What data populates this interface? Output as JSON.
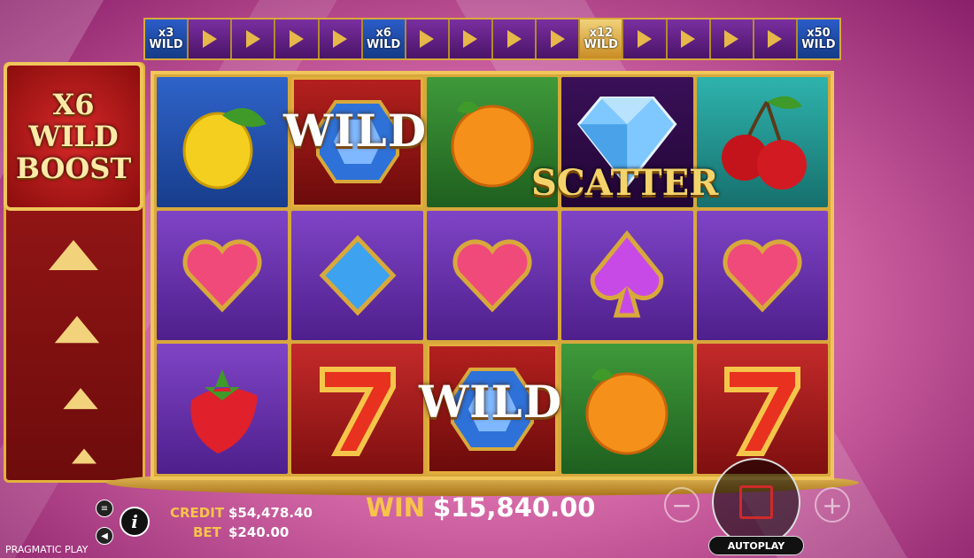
{
  "multipliers": [
    "x3\nWILD",
    "x6\nWILD",
    "x12\nWILD",
    "x50\nWILD"
  ],
  "boost": {
    "line1": "X6",
    "line2": "WILD",
    "line3": "BOOST"
  },
  "symbols": {
    "wild": "WILD",
    "scatter": "SCATTER"
  },
  "reels": [
    [
      "lemon",
      "wild-gem",
      "orange",
      "diamond-scatter",
      "cherries"
    ],
    [
      "heart",
      "blue-diamond",
      "heart",
      "spade",
      "heart"
    ],
    [
      "strawberry",
      "seven",
      "wild-gem",
      "orange",
      "seven"
    ]
  ],
  "hud": {
    "credit_label": "CREDIT",
    "credit_value": "$54,478.40",
    "bet_label": "BET",
    "bet_value": "$240.00",
    "win_label": "WIN",
    "win_value": "$15,840.00",
    "autoplay_label": "AUTOPLAY",
    "info_label": "i",
    "brand": "PRAGMATIC PLAY",
    "minus": "−",
    "plus": "+"
  },
  "colors": {
    "gold": "#f0c65a",
    "red": "#a31919",
    "purple": "#4a1468"
  }
}
